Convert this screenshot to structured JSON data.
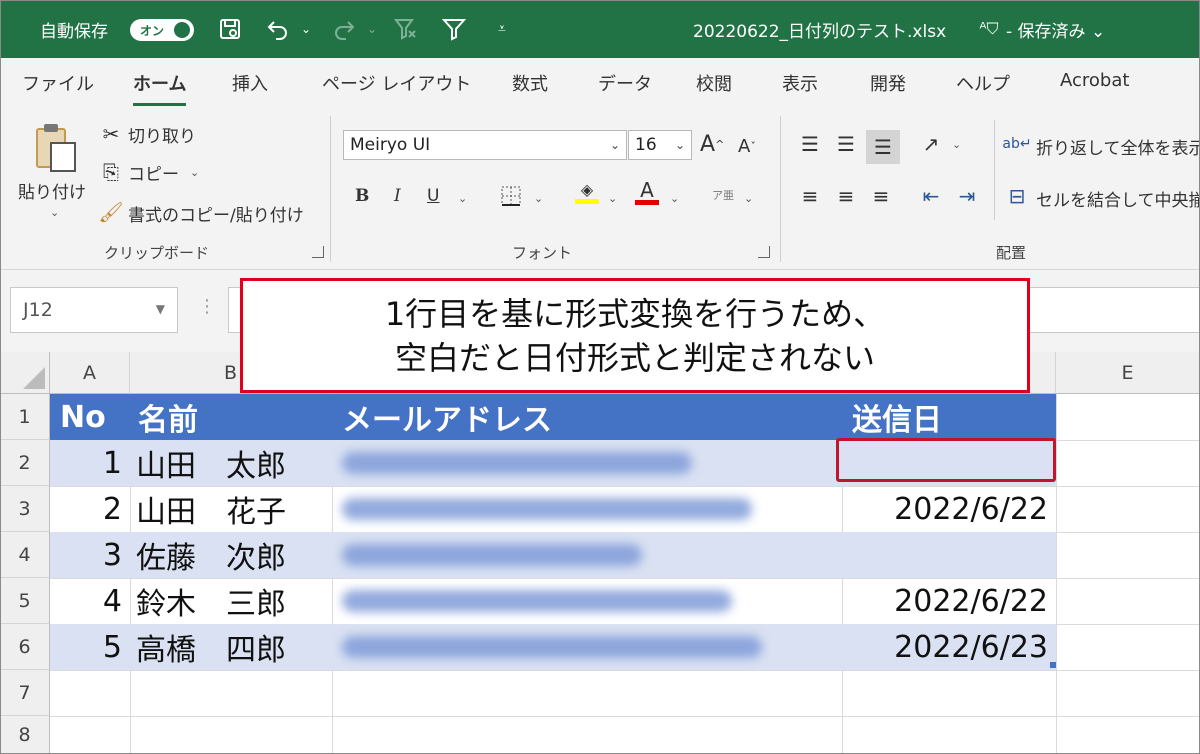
{
  "titlebar": {
    "autosave_label": "自動保存",
    "autosave_toggle": "オン",
    "filename": "20220622_日付列のテスト.xlsx",
    "save_status": "- 保存済み ⌄",
    "icons": [
      "save-icon",
      "undo-icon",
      "redo-icon",
      "clear-filter-icon",
      "filter-icon",
      "customize-qat-icon"
    ]
  },
  "tabs": [
    "ファイル",
    "ホーム",
    "挿入",
    "ページ レイアウト",
    "数式",
    "データ",
    "校閲",
    "表示",
    "開発",
    "ヘルプ",
    "Acrobat"
  ],
  "active_tab": "ホーム",
  "ribbon": {
    "clipboard": {
      "paste": "貼り付け",
      "cut": "切り取り",
      "copy": "コピー",
      "format_painter": "書式のコピー/貼り付け",
      "group_label": "クリップボード"
    },
    "font": {
      "font_name": "Meiryo UI",
      "font_size": "16",
      "grow": "A",
      "shrink": "A",
      "bold": "B",
      "italic": "I",
      "underline": "U",
      "font_color_letter": "A",
      "phonetic": "ア亜",
      "group_label": "フォント",
      "fill_color": "#ffff00",
      "font_color": "#e00000"
    },
    "alignment": {
      "wrap_text": "折り返して全体を表示",
      "merge_center": "セルを結合して中央揃え",
      "group_label": "配置"
    }
  },
  "formula_bar": {
    "name_box": "J12",
    "formula": ""
  },
  "sheet": {
    "columns": [
      "A",
      "B",
      "C",
      "D",
      "E"
    ],
    "rows": [
      "1",
      "2",
      "3",
      "4",
      "5",
      "6",
      "7",
      "8"
    ],
    "header": {
      "no": "No",
      "name": "名前",
      "email": "メールアドレス",
      "date": "送信日"
    },
    "records": [
      {
        "no": "1",
        "name": "山田　太郎",
        "date": ""
      },
      {
        "no": "2",
        "name": "山田　花子",
        "date": "2022/6/22"
      },
      {
        "no": "3",
        "name": "佐藤　次郎",
        "date": ""
      },
      {
        "no": "4",
        "name": "鈴木　三郎",
        "date": "2022/6/22"
      },
      {
        "no": "5",
        "name": "高橋　四郎",
        "date": "2022/6/23"
      }
    ],
    "table_header_color": "#4472c4",
    "band_color": "#d9e1f2"
  },
  "callout": {
    "line1": "1行目を基に形式変換を行うため、",
    "line2": "空白だと日付形式と判定されない",
    "border_color": "#e0001b"
  }
}
